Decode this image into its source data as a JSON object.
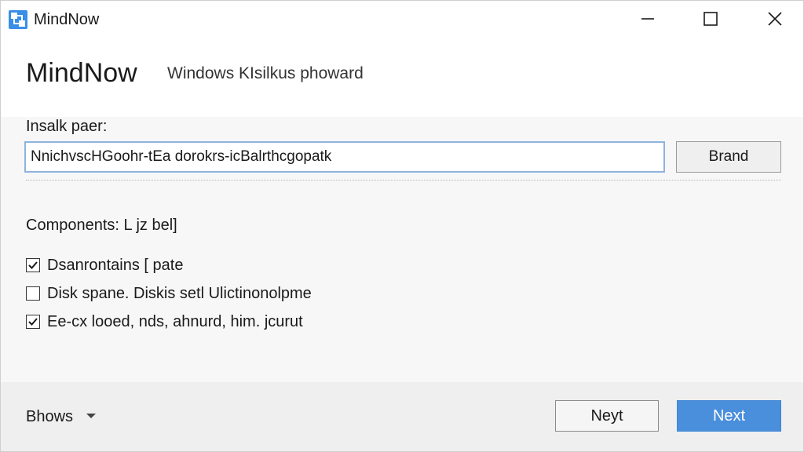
{
  "window": {
    "title": "MindNow",
    "icon": "app-logo-icon",
    "controls": {
      "minimize_icon": "minimize-icon",
      "maximize_icon": "maximize-icon",
      "close_icon": "close-icon"
    }
  },
  "header": {
    "title": "MindNow",
    "subtitle": "Windows KIsilkus phoward"
  },
  "install_path": {
    "label": "Insalk paer:",
    "value": "NnichvscHGoohr-tEa dorokrs-icBalrthcgopatk",
    "browse_label": "Brand"
  },
  "components": {
    "label": "Components:  L jz bel]",
    "items": [
      {
        "label": "Dsanrontains [ pate",
        "checked": true
      },
      {
        "label": "Disk spane. Diskis setl Ulictinonolpme",
        "checked": false
      },
      {
        "label": "Ee-cx looed, nds, ahnurd, him. jcurut",
        "checked": true
      }
    ]
  },
  "footer": {
    "dropdown_label": "Bhows",
    "secondary_button": "Neyt",
    "primary_button": "Next"
  },
  "colors": {
    "accent": "#4a8fdc",
    "input_border": "#8fb4dd",
    "footer_bg": "#efefef",
    "content_bg": "#f7f7f7"
  }
}
